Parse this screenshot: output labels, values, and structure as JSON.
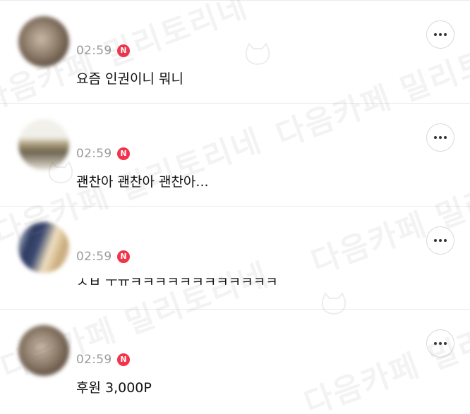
{
  "watermark": {
    "text": "다음카페 밀리토리네"
  },
  "comments": [
    {
      "time": "02:59",
      "badge": "N",
      "text": "요즘 인권이니 뭐니",
      "avatar_colors": [
        "#6b5a4a",
        "#c9b8a6"
      ]
    },
    {
      "time": "02:59",
      "badge": "N",
      "text": "괜찬아 괜찬아 괜찬아...",
      "avatar_colors": [
        "#8a7a5a",
        "#e8e2d6"
      ]
    },
    {
      "time": "02:59",
      "badge": "N",
      "text": "ㅅㅂ ㅜㅠㅋㅋㅋㅋㅋㅋㅋㅋㅋㅋㅋㅋ",
      "avatar_colors": [
        "#3c4a6a",
        "#e0c9a0"
      ]
    },
    {
      "time": "02:59",
      "badge": "N",
      "text": "후원 3,000P",
      "avatar_colors": [
        "#6b5a4a",
        "#c9b8a6"
      ]
    }
  ],
  "colors": {
    "badge": "#f2334a",
    "time": "#9a9a9a",
    "divider": "#ececec"
  }
}
